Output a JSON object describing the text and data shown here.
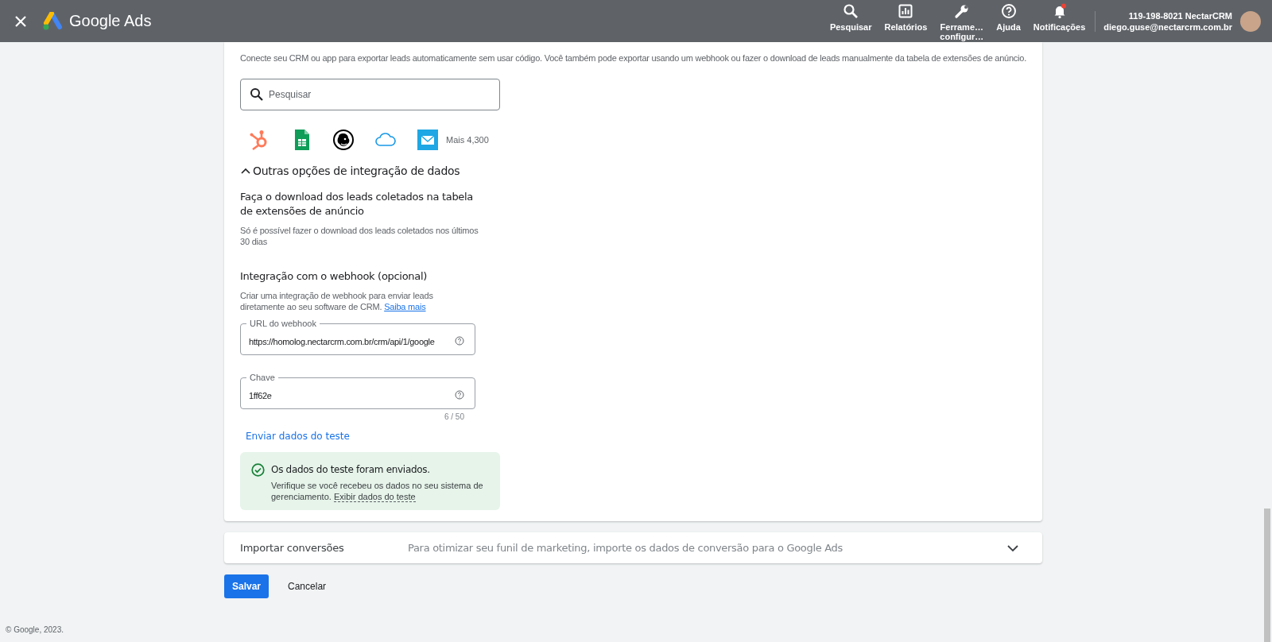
{
  "header": {
    "logo_text": "Google Ads",
    "nav": [
      {
        "kind": "search",
        "lines": [
          "Pesquisar"
        ]
      },
      {
        "kind": "reports",
        "lines": [
          "Relatórios"
        ]
      },
      {
        "kind": "tools",
        "lines": [
          "Ferrame…",
          "configur…"
        ]
      },
      {
        "kind": "help",
        "lines": [
          "Ajuda"
        ]
      },
      {
        "kind": "notifications",
        "lines": [
          "Notificações"
        ],
        "unread": true
      }
    ],
    "account": {
      "name": "119-198-8021 NectarCRM",
      "email": "diego.guse@nectarcrm.com.br"
    }
  },
  "lead_export": {
    "intro": "Conecte seu CRM ou app para exportar leads automaticamente sem usar código. Você também pode exportar usando um webhook ou fazer o download de leads manualmente da tabela de extensões de anúncio.",
    "search": {
      "placeholder": "Pesquisar"
    },
    "integrations": [
      {
        "kind": "hubspot"
      },
      {
        "kind": "sheets"
      },
      {
        "kind": "mailchimp"
      },
      {
        "kind": "cloud"
      },
      {
        "kind": "mail"
      }
    ],
    "more": "Mais 4,300",
    "other_options": {
      "title": "Outras opções de integração de dados",
      "expanded": true
    },
    "download": {
      "title": "Faça o download dos leads coletados na tabela de extensões de anúncio",
      "description": "Só é possível fazer o download dos leads coletados nos últimos 30 dias"
    },
    "webhook": {
      "title": "Integração com o webhook (opcional)",
      "description": "Criar uma integração de webhook para enviar leads diretamente ao seu software de CRM.",
      "link": "Saiba mais",
      "fields": [
        {
          "label": "URL do webhook",
          "value": "https://homolog.nectarcrm.com.br/crm/api/1/google"
        },
        {
          "label": "Chave",
          "value": "1ff62e",
          "counter": "6 / 50"
        }
      ],
      "send_test": "Enviar dados do teste",
      "result": {
        "title": "Os dados do teste foram enviados.",
        "text": "Verifique se você recebeu os dados no seu sistema de gerenciamento.",
        "link": "Exibir dados do teste"
      }
    }
  },
  "import_conversions": {
    "title": "Importar conversões",
    "description": "Para otimizar seu funil de marketing, importe os dados de conversão para o Google Ads",
    "expanded": false
  },
  "buttons": [
    {
      "kind": "primary",
      "label": "Salvar"
    },
    {
      "kind": "text",
      "label": "Cancelar"
    }
  ],
  "footer": "© Google, 2023."
}
